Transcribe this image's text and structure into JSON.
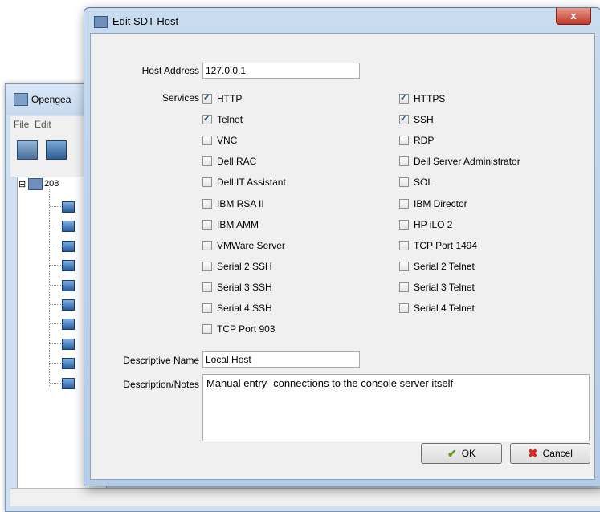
{
  "background_window": {
    "title": "Opengea",
    "menu": [
      "File",
      "Edit"
    ],
    "tree_root": "208"
  },
  "dialog": {
    "title": "Edit SDT Host",
    "close_label": "x",
    "host_address": {
      "label": "Host Address",
      "value": "127.0.0.1"
    },
    "services_label": "Services",
    "services_left": [
      {
        "label": "HTTP",
        "checked": true
      },
      {
        "label": "Telnet",
        "checked": true
      },
      {
        "label": "VNC",
        "checked": false
      },
      {
        "label": "Dell RAC",
        "checked": false
      },
      {
        "label": "Dell IT Assistant",
        "checked": false
      },
      {
        "label": "IBM RSA II",
        "checked": false
      },
      {
        "label": "IBM AMM",
        "checked": false
      },
      {
        "label": "VMWare Server",
        "checked": false
      },
      {
        "label": "Serial 2 SSH",
        "checked": false
      },
      {
        "label": "Serial 3 SSH",
        "checked": false
      },
      {
        "label": "Serial 4 SSH",
        "checked": false
      },
      {
        "label": "TCP Port 903",
        "checked": false
      }
    ],
    "services_right": [
      {
        "label": "HTTPS",
        "checked": true
      },
      {
        "label": "SSH",
        "checked": true
      },
      {
        "label": "RDP",
        "checked": false
      },
      {
        "label": "Dell Server Administrator",
        "checked": false
      },
      {
        "label": "SOL",
        "checked": false
      },
      {
        "label": "IBM Director",
        "checked": false
      },
      {
        "label": "HP iLO 2",
        "checked": false
      },
      {
        "label": "TCP Port 1494",
        "checked": false
      },
      {
        "label": "Serial 2 Telnet",
        "checked": false
      },
      {
        "label": "Serial 3 Telnet",
        "checked": false
      },
      {
        "label": "Serial 4 Telnet",
        "checked": false
      }
    ],
    "descriptive_name": {
      "label": "Descriptive Name",
      "value": "Local Host"
    },
    "notes": {
      "label": "Description/Notes",
      "value": "Manual entry- connections to the console server itself"
    },
    "ok_label": "OK",
    "cancel_label": "Cancel"
  }
}
